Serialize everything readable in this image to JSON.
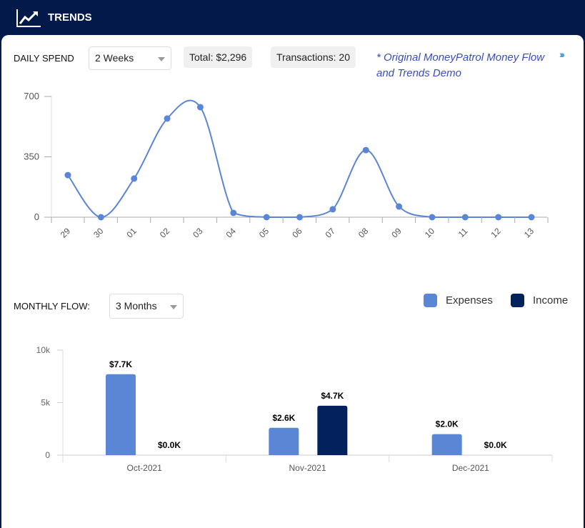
{
  "header": {
    "title": "TRENDS",
    "icon": "chart-trend-icon"
  },
  "daily": {
    "label": "DAILY SPEND",
    "period": "2 Weeks",
    "total": "Total:  $2,296",
    "transactions": "Transactions:  20",
    "note": "* Original MoneyPatrol Money Flow and Trends Demo",
    "more_icon": "double-chevron-right-icon"
  },
  "monthly": {
    "label": "MONTHLY FLOW:",
    "period": "3 Months"
  },
  "colors": {
    "header": "#03194a",
    "line": "#5b86d6",
    "expenses": "#5b86d6",
    "income": "#03215c",
    "note": "#3a4dbd"
  },
  "chart_data": [
    {
      "type": "line",
      "categories": [
        "29",
        "30",
        "01",
        "02",
        "03",
        "04",
        "05",
        "06",
        "07",
        "08",
        "09",
        "10",
        "11",
        "12",
        "13"
      ],
      "values": [
        244,
        0,
        224,
        572,
        638,
        25,
        0,
        0,
        46,
        389,
        62,
        0,
        0,
        0,
        0
      ],
      "yticks": [
        "0",
        "350",
        "700"
      ],
      "ylim": [
        0,
        700
      ],
      "grid": false
    },
    {
      "type": "bar",
      "categories": [
        "Oct-2021",
        "Nov-2021",
        "Dec-2021"
      ],
      "series": [
        {
          "name": "Expenses",
          "values": [
            7.7,
            2.6,
            2.0
          ],
          "labels": [
            "$7.7K",
            "$2.6K",
            "$2.0K"
          ]
        },
        {
          "name": "Income",
          "values": [
            0.0,
            4.7,
            0.0
          ],
          "labels": [
            "$0.0K",
            "$4.7K",
            "$0.0K"
          ]
        }
      ],
      "yticks": [
        "0",
        "5k",
        "10k"
      ],
      "ylim": [
        0,
        10
      ],
      "ylabel": "",
      "legend": "top-right",
      "grid": false
    }
  ]
}
